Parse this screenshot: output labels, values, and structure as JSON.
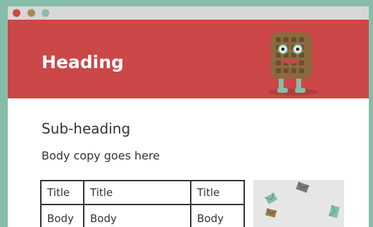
{
  "window": {
    "controls": [
      "close",
      "minimize",
      "maximize"
    ]
  },
  "hero": {
    "heading": "Heading",
    "background_color": "#cb4748",
    "mascot_icon": "waffle-character-icon"
  },
  "content": {
    "subheading": "Sub-heading",
    "body_copy": "Body copy goes here"
  },
  "table": {
    "headers": [
      "Title",
      "Title",
      "Title"
    ],
    "rows": [
      [
        "Body",
        "Body",
        "Body"
      ]
    ]
  },
  "image": {
    "icon": "flying-envelopes-illustration"
  },
  "colors": {
    "page_background": "#86bda8",
    "titlebar": "#d7d7d7",
    "close_dot": "#cf4749",
    "minimize_dot": "#a98a55",
    "maximize_dot": "#86bda8"
  }
}
